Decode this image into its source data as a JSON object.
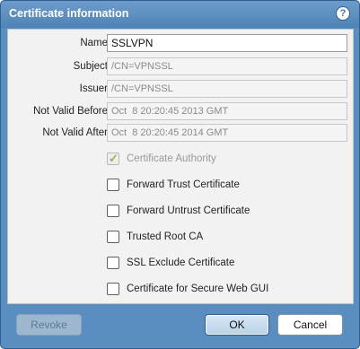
{
  "dialog": {
    "title": "Certificate information",
    "help_icon": "?"
  },
  "fields": [
    {
      "label": "Name",
      "value": "SSLVPN"
    },
    {
      "label": "Subject",
      "value": "/CN=VPNSSL"
    },
    {
      "label": "Issuer",
      "value": "/CN=VPNSSL"
    },
    {
      "label": "Not Valid Before",
      "value": "Oct  8 20:20:45 2013 GMT"
    },
    {
      "label": "Not Valid After",
      "value": "Oct  8 20:20:45 2014 GMT"
    }
  ],
  "checkboxes": [
    {
      "label": "Certificate Authority",
      "checked": true,
      "disabled": true
    },
    {
      "label": "Forward Trust Certificate",
      "checked": false,
      "disabled": false
    },
    {
      "label": "Forward Untrust Certificate",
      "checked": false,
      "disabled": false
    },
    {
      "label": "Trusted Root CA",
      "checked": false,
      "disabled": false
    },
    {
      "label": "SSL Exclude Certificate",
      "checked": false,
      "disabled": false
    },
    {
      "label": "Certificate for Secure Web GUI",
      "checked": false,
      "disabled": false
    }
  ],
  "buttons": {
    "revoke": "Revoke",
    "ok": "OK",
    "cancel": "Cancel"
  },
  "colors": {
    "dialog_frame": "#5a8ec0",
    "title_text": "#ffffff",
    "check_mark": "#8bb35a"
  }
}
